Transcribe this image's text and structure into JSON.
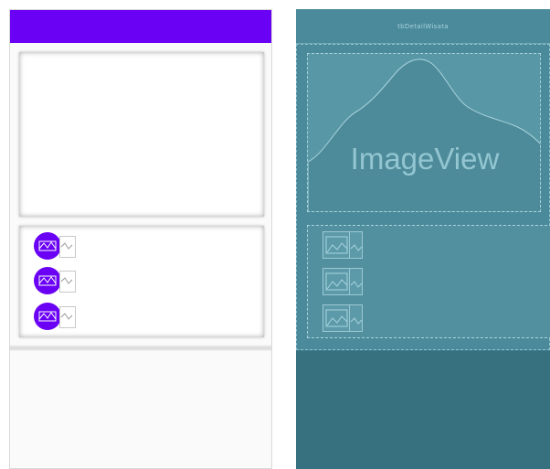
{
  "blueprint": {
    "title": "tbDetailWisata",
    "image_label": "ImageView"
  },
  "colors": {
    "accent": "#6a00f4",
    "blueprint_bg": "#3d7b8c",
    "blueprint_line": "#a9d4dd"
  },
  "icons": {
    "row_item": "image-placeholder-icon",
    "blueprint_image": "mountain-placeholder-icon"
  },
  "list_rows_count": 3
}
